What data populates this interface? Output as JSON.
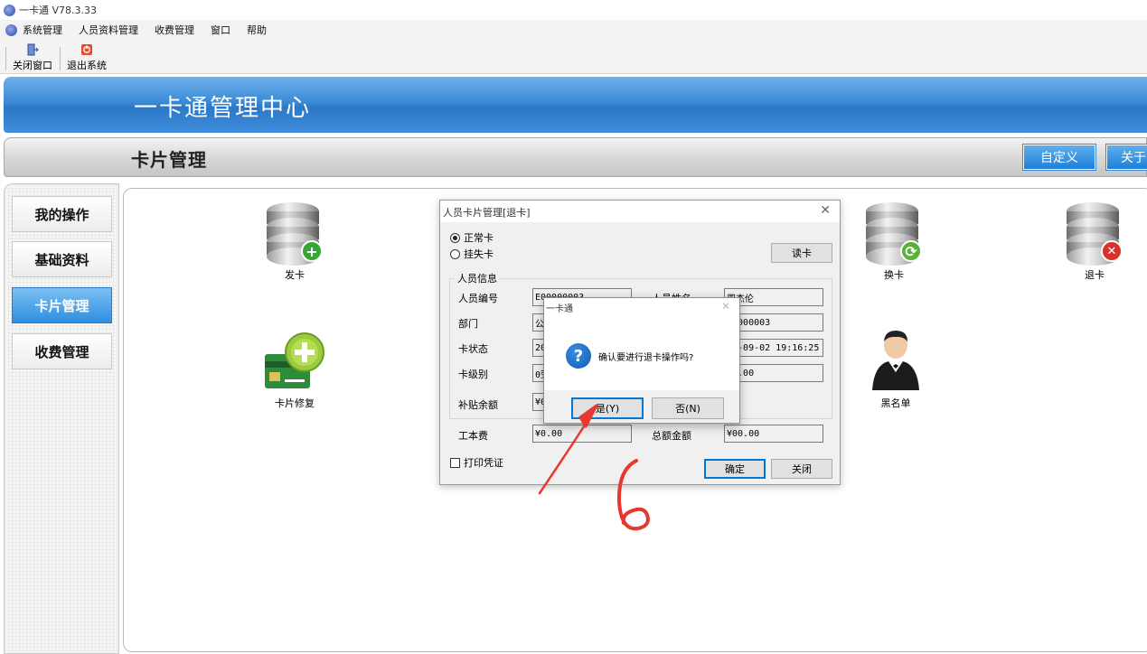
{
  "window": {
    "title": "一卡通 V78.3.33"
  },
  "menu": {
    "items": [
      "系统管理",
      "人员资料管理",
      "收费管理",
      "窗口",
      "帮助"
    ]
  },
  "toolbar": {
    "close_window": "关闭窗口",
    "exit_system": "退出系统"
  },
  "banner": {
    "title": "一卡通管理中心"
  },
  "section": {
    "title": "卡片管理",
    "custom_button": "自定义",
    "close_button_partial": "关于"
  },
  "sidebar": {
    "items": [
      "我的操作",
      "基础资料",
      "卡片管理",
      "收费管理"
    ],
    "active_index": 2
  },
  "functions": {
    "issue": "发卡",
    "replace": "换卡",
    "refund": "退卡",
    "repair": "卡片修复",
    "blacklist": "黑名单"
  },
  "dialog_card": {
    "title": "人员卡片管理[退卡]",
    "radio_normal": "正常卡",
    "radio_lost": "挂失卡",
    "read_button": "读卡",
    "group_title": "人员信息",
    "labels": {
      "person_no": "人员编号",
      "dept": "部门",
      "card_status": "卡状态",
      "card_level": "卡级别",
      "subsidy": "补贴余额",
      "fee": "工本费",
      "name_partial": "人员姓名",
      "total_partial": "总额金额"
    },
    "values": {
      "person_no": "E00000003",
      "dept": "公",
      "card_status": "20",
      "card_level": "0劳",
      "subsidy": "¥0",
      "fee": "¥0.00",
      "name": "周杰伦",
      "card_no": "00000003",
      "time": "20-09-02 19:16:25",
      "amount": "¥0.00",
      "total": "¥00.00"
    },
    "print_check": "打印凭证",
    "ok_button": "确定",
    "close_button": "关闭"
  },
  "confirm_dialog": {
    "title": "一卡通",
    "message": "确认要进行退卡操作吗?",
    "yes_button": "是(Y)",
    "no_button": "否(N)"
  },
  "annotation": {
    "text": "6",
    "color": "#e8372f"
  },
  "colors": {
    "accent": "#2f8ee0",
    "annotation": "#e8372f"
  }
}
